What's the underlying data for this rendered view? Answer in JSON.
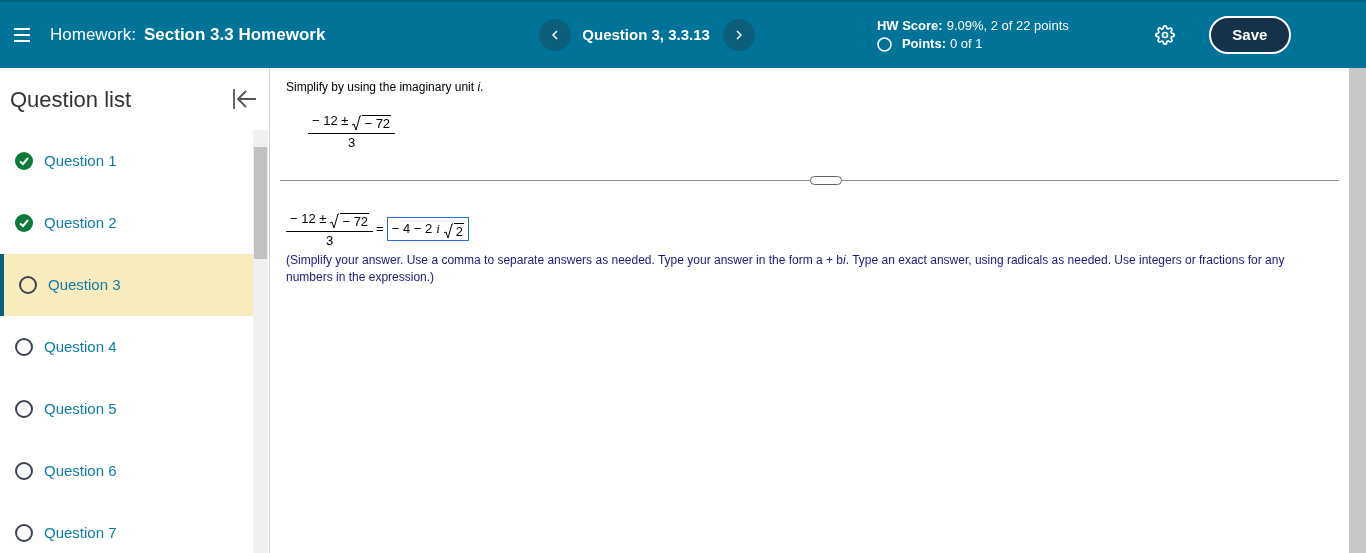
{
  "header": {
    "label": "Homework:",
    "title": "Section 3.3 Homework",
    "question": "Question 3, 3.3.13",
    "score_label": "HW Score:",
    "score": "9.09%, 2 of 22 points",
    "points_label": "Points:",
    "points": "0 of 1",
    "save": "Save"
  },
  "sidebar": {
    "title": "Question list",
    "items": [
      {
        "label": "Question 1",
        "completed": true,
        "selected": false
      },
      {
        "label": "Question 2",
        "completed": true,
        "selected": false
      },
      {
        "label": "Question 3",
        "completed": false,
        "selected": true
      },
      {
        "label": "Question 4",
        "completed": false,
        "selected": false
      },
      {
        "label": "Question 5",
        "completed": false,
        "selected": false
      },
      {
        "label": "Question 6",
        "completed": false,
        "selected": false
      },
      {
        "label": "Question 7",
        "completed": false,
        "selected": false
      }
    ]
  },
  "question": {
    "prompt": "Simplify by using the imaginary unit *i*.",
    "expression": {
      "numerator": "− 12 ±",
      "radicand": "− 72",
      "denominator": "3"
    }
  },
  "answer": {
    "expression": {
      "numerator": "− 12 ±",
      "radicand": "− 72",
      "denominator": "3"
    },
    "equals": "=",
    "value": "− 4 − 2",
    "unit": "i",
    "radicand": "2",
    "instructions": {
      "before": "(Simplify your answer. Use a comma to separate answers as needed. Type your answer in the form a + b",
      "italic": "i",
      "after": ". Type an exact answer, using radicals as needed. Use integers or fractions for any numbers in the expression.)"
    }
  }
}
